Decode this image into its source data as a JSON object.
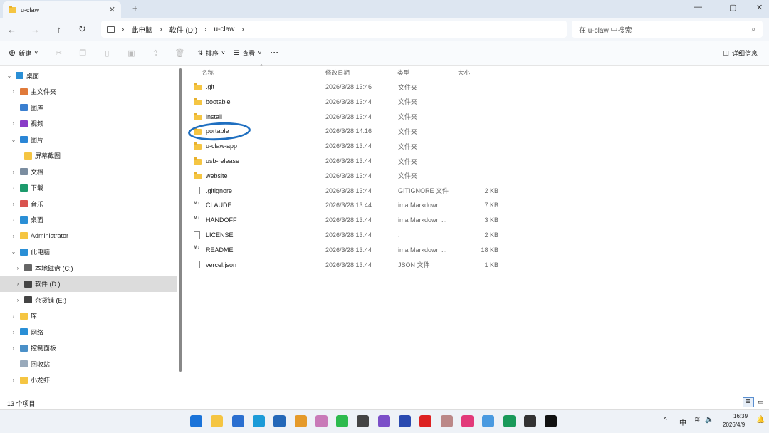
{
  "window": {
    "tab_title": "u-claw",
    "close": "✕",
    "new_tab": "+",
    "min": "—",
    "max": "▢",
    "close_win": "✕"
  },
  "nav": {
    "back": "←",
    "forward": "→",
    "up": "↑",
    "refresh": "↻"
  },
  "breadcrumb": [
    "此电脑",
    "软件 (D:)",
    "u-claw"
  ],
  "search": {
    "placeholder": "在 u-claw 中搜索"
  },
  "toolbar": {
    "new": "新建",
    "sort": "排序",
    "view": "查看",
    "more": "···",
    "details": "详细信息"
  },
  "sidebar": [
    {
      "label": "桌面",
      "chev": "⌄",
      "level": 0,
      "color": "#2a8fd6"
    },
    {
      "label": "主文件夹",
      "chev": "›",
      "level": 1,
      "color": "#e07a3a"
    },
    {
      "label": "图库",
      "chev": "",
      "level": 1,
      "color": "#3a7fd0"
    },
    {
      "label": "视频",
      "chev": "›",
      "level": 1,
      "color": "#8a3cc8"
    },
    {
      "label": "图片",
      "chev": "⌄",
      "level": 1,
      "color": "#2a86d6"
    },
    {
      "label": "屏幕截图",
      "chev": "",
      "level": 2,
      "color": "#f5c542"
    },
    {
      "label": "文档",
      "chev": "›",
      "level": 1,
      "color": "#7b8da0"
    },
    {
      "label": "下载",
      "chev": "›",
      "level": 1,
      "color": "#1c9a6c"
    },
    {
      "label": "音乐",
      "chev": "›",
      "level": 1,
      "color": "#d9534f"
    },
    {
      "label": "桌面",
      "chev": "›",
      "level": 1,
      "color": "#2a8fd6"
    },
    {
      "label": "Administrator",
      "chev": "›",
      "level": 1,
      "color": "#f5c542"
    },
    {
      "label": "此电脑",
      "chev": "⌄",
      "level": 1,
      "color": "#2a8fd6"
    },
    {
      "label": "本地磁盘 (C:)",
      "chev": "›",
      "level": 2,
      "color": "#666"
    },
    {
      "label": "软件 (D:)",
      "chev": "›",
      "level": 2,
      "color": "#444",
      "selected": true
    },
    {
      "label": "杂货铺 (E:)",
      "chev": "›",
      "level": 2,
      "color": "#444"
    },
    {
      "label": "库",
      "chev": "›",
      "level": 1,
      "color": "#f5c542"
    },
    {
      "label": "网络",
      "chev": "›",
      "level": 1,
      "color": "#2a8fd6"
    },
    {
      "label": "控制面板",
      "chev": "›",
      "level": 1,
      "color": "#4a90c8"
    },
    {
      "label": "回收站",
      "chev": "",
      "level": 1,
      "color": "#9ab"
    },
    {
      "label": "小龙虾",
      "chev": "›",
      "level": 1,
      "color": "#f5c542"
    }
  ],
  "columns": {
    "name": "名称",
    "date": "修改日期",
    "type": "类型",
    "size": "大小"
  },
  "files": [
    {
      "name": ".git",
      "date": "2026/3/28 13:46",
      "type": "文件夹",
      "size": "",
      "icon": "folder"
    },
    {
      "name": "bootable",
      "date": "2026/3/28 13:44",
      "type": "文件夹",
      "size": "",
      "icon": "folder"
    },
    {
      "name": "install",
      "date": "2026/3/28 13:44",
      "type": "文件夹",
      "size": "",
      "icon": "folder"
    },
    {
      "name": "portable",
      "date": "2026/3/28 14:16",
      "type": "文件夹",
      "size": "",
      "icon": "folder"
    },
    {
      "name": "u-claw-app",
      "date": "2026/3/28 13:44",
      "type": "文件夹",
      "size": "",
      "icon": "folder"
    },
    {
      "name": "usb-release",
      "date": "2026/3/28 13:44",
      "type": "文件夹",
      "size": "",
      "icon": "folder"
    },
    {
      "name": "website",
      "date": "2026/3/28 13:44",
      "type": "文件夹",
      "size": "",
      "icon": "folder"
    },
    {
      "name": ".gitignore",
      "date": "2026/3/28 13:44",
      "type": "GITIGNORE 文件",
      "size": "2 KB",
      "icon": "file"
    },
    {
      "name": "CLAUDE",
      "date": "2026/3/28 13:44",
      "type": "ima Markdown ...",
      "size": "7 KB",
      "icon": "md"
    },
    {
      "name": "HANDOFF",
      "date": "2026/3/28 13:44",
      "type": "ima Markdown ...",
      "size": "3 KB",
      "icon": "md"
    },
    {
      "name": "LICENSE",
      "date": "2026/3/28 13:44",
      "type": ".",
      "size": "2 KB",
      "icon": "file"
    },
    {
      "name": "README",
      "date": "2026/3/28 13:44",
      "type": "ima Markdown ...",
      "size": "18 KB",
      "icon": "md"
    },
    {
      "name": "vercel.json",
      "date": "2026/3/28 13:44",
      "type": "JSON 文件",
      "size": "1 KB",
      "icon": "file"
    }
  ],
  "status": {
    "count": "13 个项目"
  },
  "annotation_color": "#1f6fc0",
  "taskbar": {
    "apps": [
      {
        "name": "start",
        "color": "#1a73d9"
      },
      {
        "name": "file-explorer",
        "color": "#f5c542"
      },
      {
        "name": "outlook",
        "color": "#2a6fd0"
      },
      {
        "name": "edge",
        "color": "#1b9bd8"
      },
      {
        "name": "store",
        "color": "#2367b8"
      },
      {
        "name": "vmware",
        "color": "#e59a2a"
      },
      {
        "name": "snipping",
        "color": "#c97ab8"
      },
      {
        "name": "wechat",
        "color": "#2dbb4e"
      },
      {
        "name": "panda",
        "color": "#444"
      },
      {
        "name": "visual-studio",
        "color": "#7b4fc8"
      },
      {
        "name": "photoshop",
        "color": "#2a4ab0"
      },
      {
        "name": "record",
        "color": "#d22"
      },
      {
        "name": "avatar-app",
        "color": "#b88"
      },
      {
        "name": "pink-app",
        "color": "#e23a7a"
      },
      {
        "name": "baidu-pan",
        "color": "#4a9ae0"
      },
      {
        "name": "wps-sheet",
        "color": "#1a9a5a"
      },
      {
        "name": "terminal",
        "color": "#333"
      },
      {
        "name": "capcut",
        "color": "#111"
      }
    ],
    "ime": "中",
    "chevron": "^",
    "time": "16:39",
    "date": "2026/4/9"
  }
}
